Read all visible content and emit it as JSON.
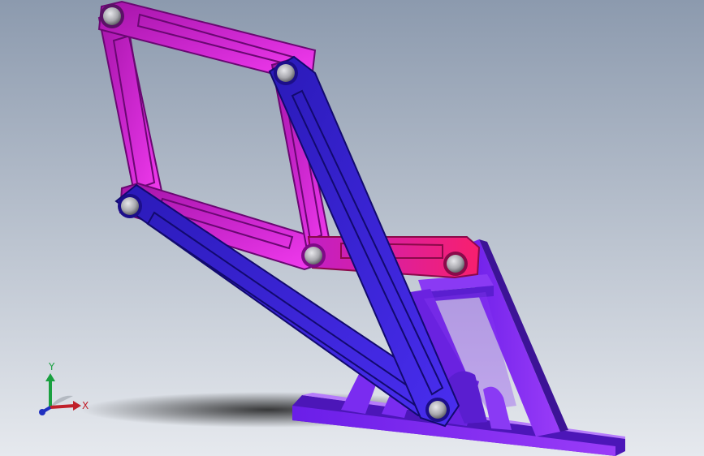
{
  "viewport": {
    "background_top": "#8c9aae",
    "background_bottom": "#e6e9ee"
  },
  "colors": {
    "magenta_link": "#c21fc6",
    "magenta_dark": "#7e0a86",
    "pink_link": "#f0208a",
    "blue_link": "#3a1fd6",
    "blue_dark": "#1c0e8a",
    "base_purple": "#7a2cf0",
    "base_dark": "#3c1396",
    "pin": "#b9b9bd"
  },
  "triad": {
    "x_label": "X",
    "y_label": "Y",
    "x_color": "#c0202a",
    "y_color": "#1aa040",
    "z_color": "#2030c0"
  }
}
